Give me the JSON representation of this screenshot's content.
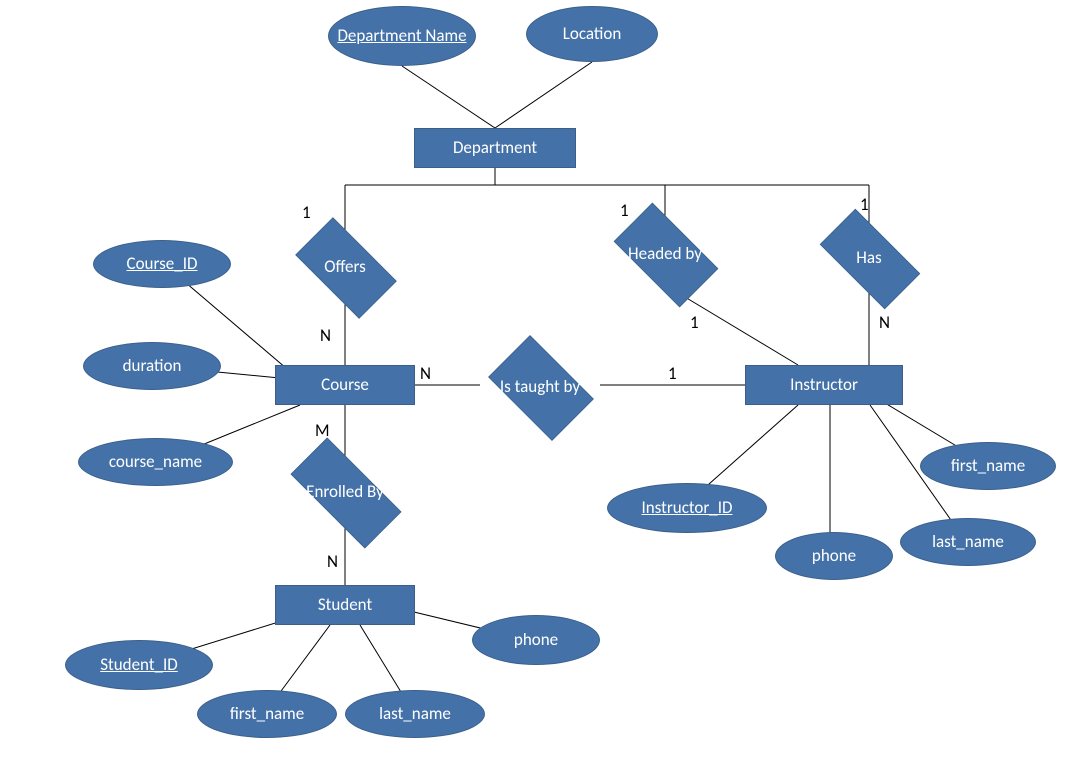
{
  "entities": {
    "department": "Department",
    "course": "Course",
    "instructor": "Instructor",
    "student": "Student"
  },
  "relationships": {
    "offers": "Offers",
    "headed_by": "Headed by",
    "has": "Has",
    "is_taught_by": "Is taught by",
    "enrolled_by": "Enrolled By"
  },
  "attributes": {
    "department_name": "Department Name",
    "location": "Location",
    "course_id": "Course_ID",
    "duration": "duration",
    "course_name": "course_name",
    "instructor_id": "Instructor_ID",
    "instr_first_name": "first_name",
    "instr_last_name": "last_name",
    "instr_phone": "phone",
    "student_id": "Student_ID",
    "stud_first_name": "first_name",
    "stud_last_name": "last_name",
    "stud_phone": "phone"
  },
  "cardinalities": {
    "offers_dep": "1",
    "offers_course": "N",
    "headed_dep": "1",
    "headed_instr": "1",
    "has_dep": "1",
    "has_instr": "N",
    "taught_course": "N",
    "taught_instr": "1",
    "enrolled_course": "M",
    "enrolled_student": "N"
  }
}
